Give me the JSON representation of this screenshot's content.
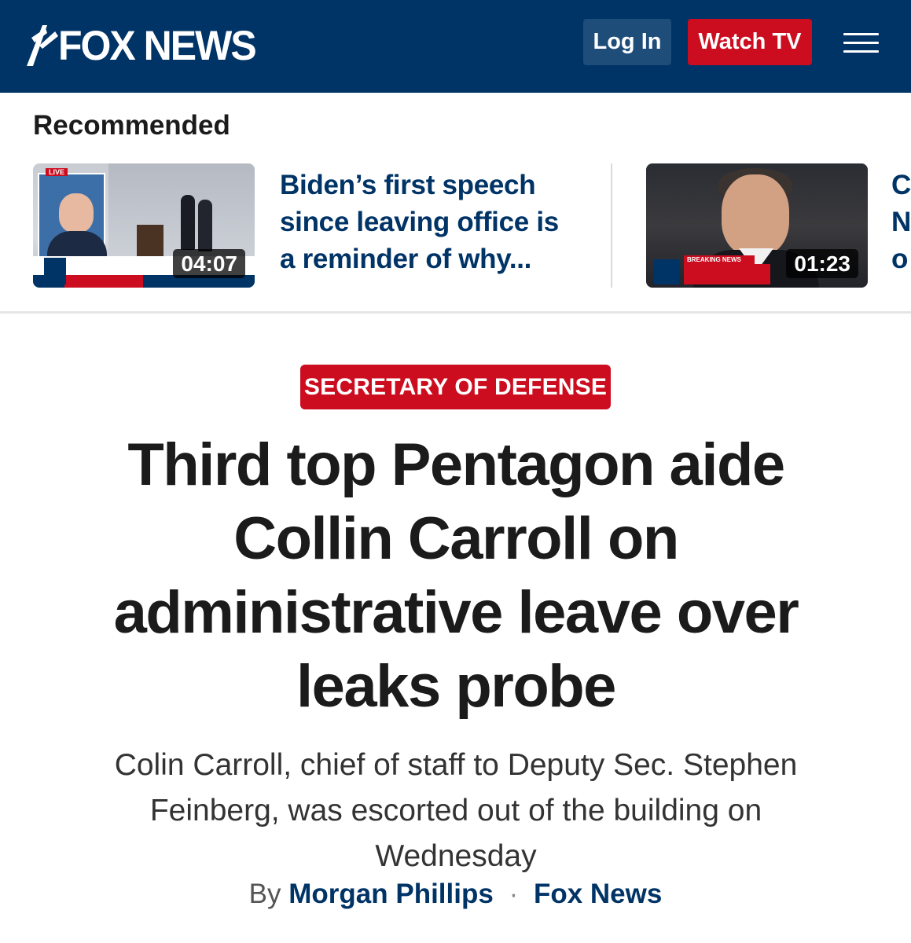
{
  "header": {
    "logo_text": "FOX NEWS",
    "login_label": "Log In",
    "watch_label": "Watch TV",
    "colors": {
      "header_bg": "#003366",
      "watch_bg": "#cc0d20",
      "login_bg": "#1f4d7a"
    }
  },
  "recommended": {
    "title": "Recommended",
    "items": [
      {
        "duration": "04:07",
        "headline_lines": [
          "Biden’s first speech",
          "since leaving office is",
          "a reminder of why..."
        ]
      },
      {
        "duration": "01:23",
        "headline_lines": [
          "C",
          "N",
          "o"
        ]
      }
    ],
    "thumb_texts": {
      "live": "LIVE",
      "breaking": "BREAKING NEWS"
    }
  },
  "article": {
    "category": "SECRETARY OF DEFENSE",
    "headline_lines": [
      "Third top Pentagon aide",
      "Collin Carroll on",
      "administrative leave over",
      "leaks probe"
    ],
    "dek_lines": [
      "Colin Carroll, chief of staff to Deputy Sec. Stephen",
      "Feinberg, was escorted out of the building on",
      "Wednesday"
    ],
    "byline": {
      "prefix": "By",
      "author": "Morgan Phillips",
      "separator": "·",
      "source": "Fox News"
    }
  },
  "icons": {
    "menu": "hamburger-menu-icon",
    "logo": "fox-news-logo"
  }
}
